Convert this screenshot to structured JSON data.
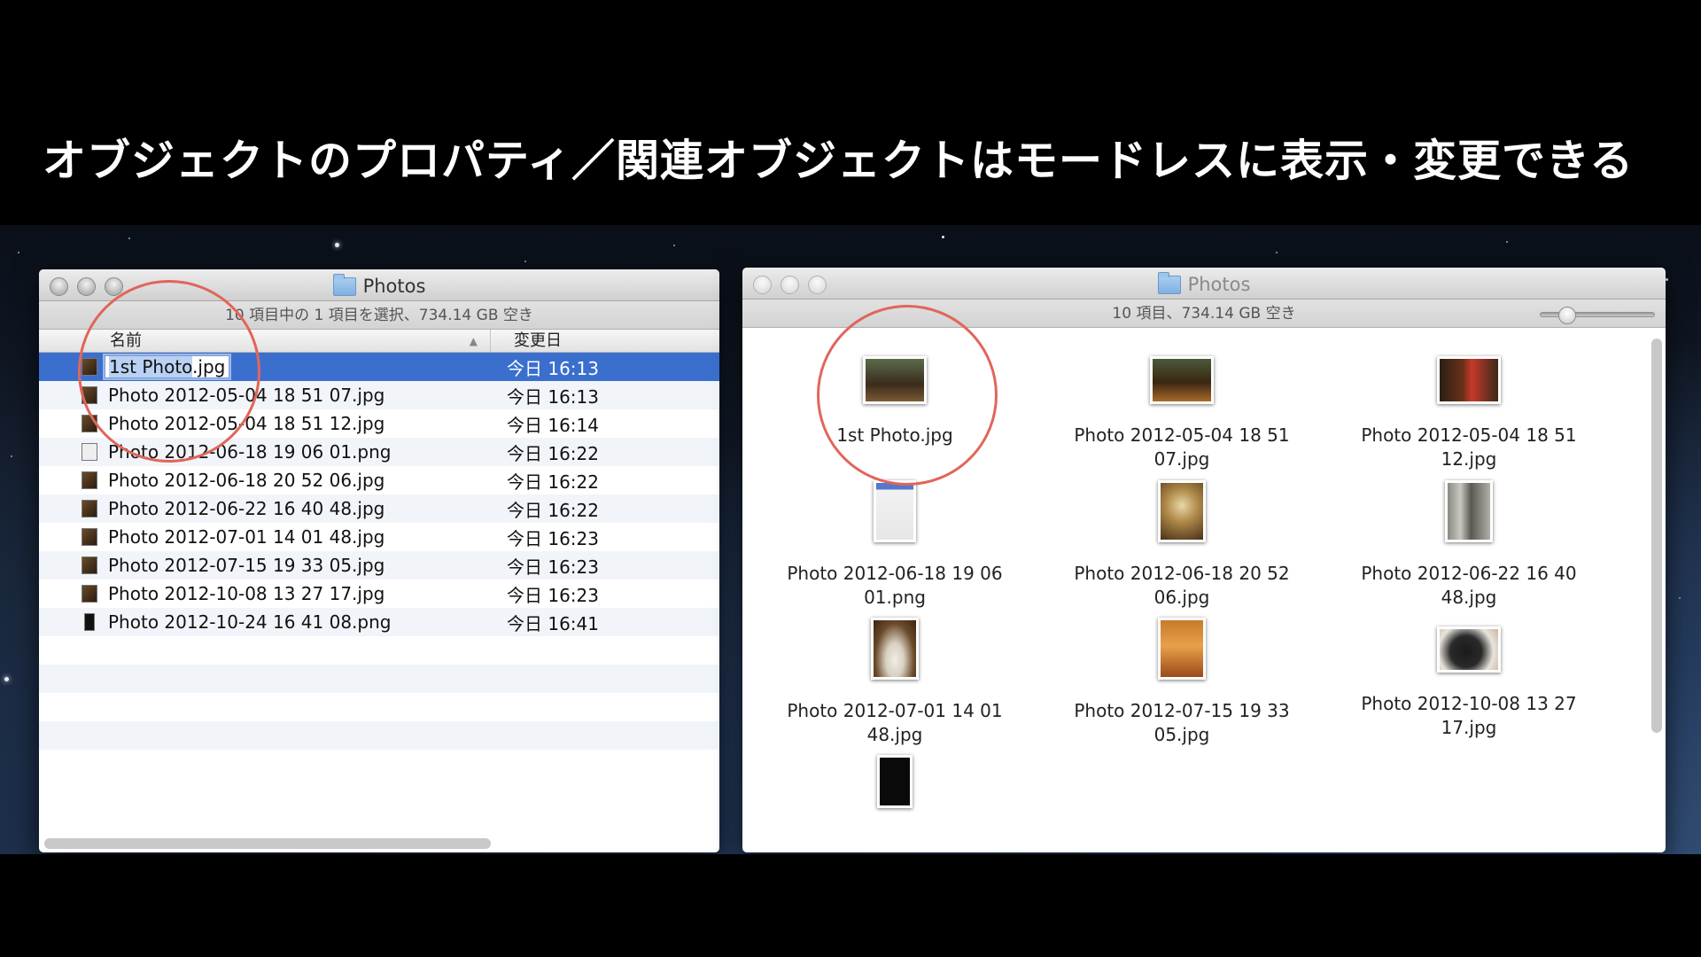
{
  "slide": {
    "title": "オブジェクトのプロパティ／関連オブジェクトはモードレスに表示・変更できる"
  },
  "list_window": {
    "title": "Photos",
    "status": "10 項目中の 1 項目を選択、734.14 GB 空き",
    "columns": {
      "name": "名前",
      "date": "変更日"
    },
    "rows": [
      {
        "name_a": "1st Photo",
        "name_b": ".jpg",
        "date": "今日 16:13"
      },
      {
        "name": "Photo 2012-05-04 18 51 07.jpg",
        "date": "今日 16:13"
      },
      {
        "name": "Photo 2012-05-04 18 51 12.jpg",
        "date": "今日 16:14"
      },
      {
        "name": "Photo 2012-06-18 19 06 01.png",
        "date": "今日 16:22"
      },
      {
        "name": "Photo 2012-06-18 20 52 06.jpg",
        "date": "今日 16:22"
      },
      {
        "name": "Photo 2012-06-22 16 40 48.jpg",
        "date": "今日 16:22"
      },
      {
        "name": "Photo 2012-07-01 14 01 48.jpg",
        "date": "今日 16:23"
      },
      {
        "name": "Photo 2012-07-15 19 33 05.jpg",
        "date": "今日 16:23"
      },
      {
        "name": "Photo 2012-10-08 13 27 17.jpg",
        "date": "今日 16:23"
      },
      {
        "name": "Photo 2012-10-24 16 41 08.png",
        "date": "今日 16:41"
      }
    ]
  },
  "icon_window": {
    "title": "Photos",
    "status": "10 項目、734.14 GB 空き",
    "items": [
      {
        "label": "1st Photo.jpg"
      },
      {
        "label": "Photo 2012-05-04 18 51\n07.jpg"
      },
      {
        "label": "Photo 2012-05-04 18 51\n12.jpg"
      },
      {
        "label": "Photo 2012-06-18 19 06\n01.png"
      },
      {
        "label": "Photo 2012-06-18 20 52\n06.jpg"
      },
      {
        "label": "Photo 2012-06-22 16 40\n48.jpg"
      },
      {
        "label": "Photo 2012-07-01 14 01\n48.jpg"
      },
      {
        "label": "Photo 2012-07-15 19 33\n05.jpg"
      },
      {
        "label": "Photo 2012-10-08 13 27\n17.jpg"
      },
      {
        "label": ""
      }
    ]
  },
  "colors": {
    "selection": "#3a6fce",
    "highlight_circle": "#e0665a"
  }
}
